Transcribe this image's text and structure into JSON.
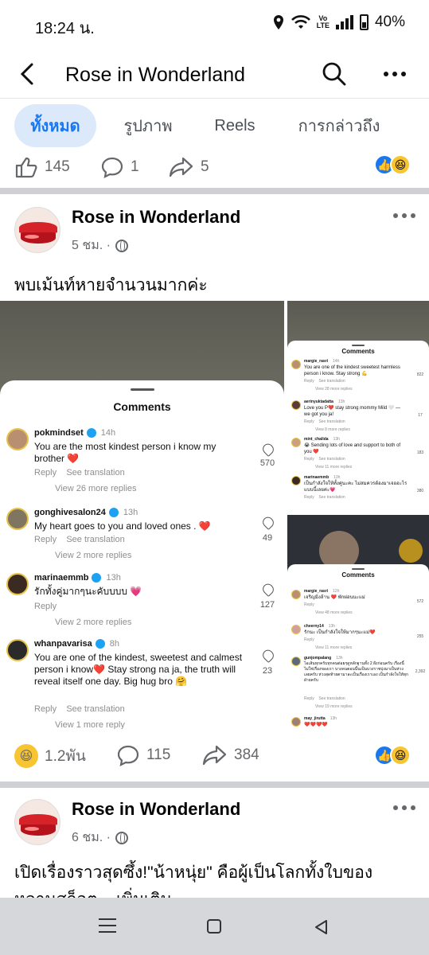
{
  "status_bar": {
    "time": "18:24 น.",
    "volte_top": "Vo",
    "volte_bottom": "LTE",
    "battery": "40%",
    "icons": [
      "location-icon",
      "wifi-icon",
      "signal-icon",
      "battery-icon"
    ]
  },
  "header": {
    "title": "Rose in Wonderland",
    "icons": [
      "back-arrow-icon",
      "search-icon",
      "more-icon"
    ]
  },
  "tabs": [
    {
      "label": "ทั้งหมด",
      "active": true
    },
    {
      "label": "รูปภาพ",
      "active": false
    },
    {
      "label": "Reels",
      "active": false
    },
    {
      "label": "การกล่าวถึง",
      "active": false
    }
  ],
  "prev_post_stats": {
    "likes": "145",
    "comments": "1",
    "shares": "5"
  },
  "post1": {
    "name": "Rose in Wonderland",
    "time": "5 ชม. ·",
    "text": "พบเม้นท์หายจำนวนมากค่ะ",
    "screenshot_main": {
      "title": "Comments",
      "comments": [
        {
          "user": "pokmindset",
          "time": "14h",
          "text": "You are the most kindest person i know my brother ❤️",
          "sub": "Reply    See translation",
          "more": "View 26 more replies",
          "likes": "570"
        },
        {
          "user": "gonghivesalon24",
          "time": "13h",
          "text": "My heart goes to you and loved ones . ❤️",
          "sub": "Reply    See translation",
          "more": "View 2 more replies",
          "likes": "49"
        },
        {
          "user": "marinaemmb",
          "time": "13h",
          "text": "รักทั้งคู่มากๆนะคับบบบ 💗",
          "sub": "Reply",
          "more": "View 2 more replies",
          "likes": "127"
        },
        {
          "user": "whanpavarisa",
          "time": "8h",
          "text": "You are one of the kindest, sweetest and calmest person i know❤️ Stay strong na ja, the truth will reveal itself one day. Big hug bro 🤗",
          "sub": "Reply    See translation",
          "more": "View 1 more reply",
          "likes": "23"
        }
      ]
    },
    "screenshot_side1": {
      "title": "Comments",
      "comments": [
        {
          "user": "margie_rasri",
          "time": "14h",
          "text": "You are one of the kindest sweetest harmless person i know. Stay strong 💪",
          "sub": "Reply    See translation",
          "more": "View 28 more replies",
          "likes": "822"
        },
        {
          "user": "aerinyuktadatta",
          "time": "13h",
          "text": "Love you P❤️ stay strong mommy Mild 🤍 — we got you ja!",
          "sub": "Reply    See translation",
          "more": "View 8 more replies",
          "likes": "17"
        },
        {
          "user": "mint_chalida",
          "time": "13h",
          "text": "😭 Sending lots of love and support to both of you ❤️",
          "sub": "Reply    See translation",
          "more": "View 11 more replies",
          "likes": "183"
        },
        {
          "user": "marinaemmb",
          "time": "13h",
          "text": "เป็นกำลังใจให้ทั้งคู่นะคะ ไม่สมควรต้องมาเจออะไรแบบนี้เลยค่ะ💗",
          "sub": "Reply    See translation",
          "more": "",
          "likes": "380"
        }
      ]
    },
    "screenshot_side2": {
      "title": "Comments",
      "comments": [
        {
          "user": "margie_rasri",
          "time": "12h",
          "text": "เจริญมิ่งล้าน ❤️ พักผ่อนนะแม่",
          "sub": "Reply",
          "more": "View 48 more replies",
          "likes": "572"
        },
        {
          "user": "cheerny14",
          "time": "13h",
          "text": "รักนะ เป็นกำลังใจให้มากๆนะแม่❤️",
          "sub": "Reply",
          "more": "View 11 more replies",
          "likes": "255"
        },
        {
          "user": "gunjompalang",
          "time": "13h",
          "text": "ไอเส้นทุกครับทุกคนต่อยๆดูหลักฐานทั้ง 2 ฝั่งก่อนครับ เรื่องนี้ไม่ใช่เรื่องของเรา บางคนตอนนี้นเป็นบวงราชบุ่งมาเป็นห่วงเลยครับ ห่วงสุดท้ายตามาละเป็นเรื่องเราเอง เป็นกำลังใจให้ทุกฝ่ายครับ",
          "sub": "Reply    See translation",
          "more": "View 19 more replies",
          "likes": "2,392"
        },
        {
          "user": "may_jirutta",
          "time": "13h",
          "text": "❤️❤️❤️❤️",
          "sub": "",
          "more": "",
          "likes": ""
        }
      ]
    },
    "stats": {
      "reactions": "1.2พัน",
      "comments": "115",
      "shares": "384"
    }
  },
  "post2": {
    "name": "Rose in Wonderland",
    "time": "6 ชม. ·",
    "text_line1": "เปิดเรื่องราวสุดซึ้ง!\"น้าหนุ่ย\" คือผู้เป็นโลกทั้งใบของ",
    "text_line2": "หลานสก็อต ...เพิ่มเติม"
  },
  "navbar": {
    "icons": [
      "recent-apps-icon",
      "home-icon",
      "back-icon"
    ]
  },
  "colors": {
    "accent": "#1877f2",
    "tab_active_bg": "#dce9fb",
    "divider": "#ced0d4",
    "muted": "#65676b"
  }
}
